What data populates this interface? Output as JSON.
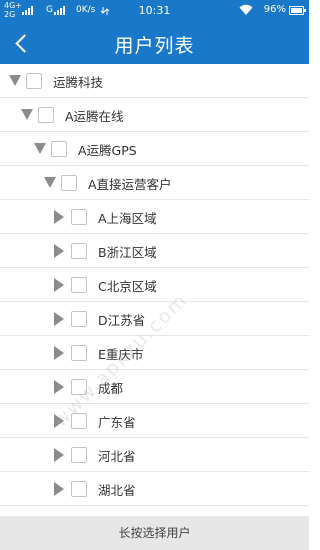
{
  "status_bar": {
    "network_top": "4G+",
    "network_bottom": "2G",
    "network_mid": "G",
    "speed": "0K/s",
    "time": "10:31",
    "battery": "96%",
    "battery_level": 0.96
  },
  "header": {
    "title": "用户列表",
    "back_icon": "chevron-left-icon",
    "color": "#1a78c8"
  },
  "tree": [
    {
      "label": "运腾科技",
      "expanded": true
    },
    {
      "label": "A运腾在线",
      "expanded": true
    },
    {
      "label": "A运腾GPS",
      "expanded": true
    },
    {
      "label": "A直接运营客户",
      "expanded": true
    },
    {
      "label": "A上海区域",
      "expanded": false
    },
    {
      "label": "B浙江区域",
      "expanded": false
    },
    {
      "label": "C北京区域",
      "expanded": false
    },
    {
      "label": "D江苏省",
      "expanded": false
    },
    {
      "label": "E重庆市",
      "expanded": false
    },
    {
      "label": "成都",
      "expanded": false
    },
    {
      "label": "广东省",
      "expanded": false
    },
    {
      "label": "河北省",
      "expanded": false
    },
    {
      "label": "湖北省",
      "expanded": false
    }
  ],
  "footer": {
    "label": "长按选择用户"
  },
  "watermark": "www.apkzu.com"
}
